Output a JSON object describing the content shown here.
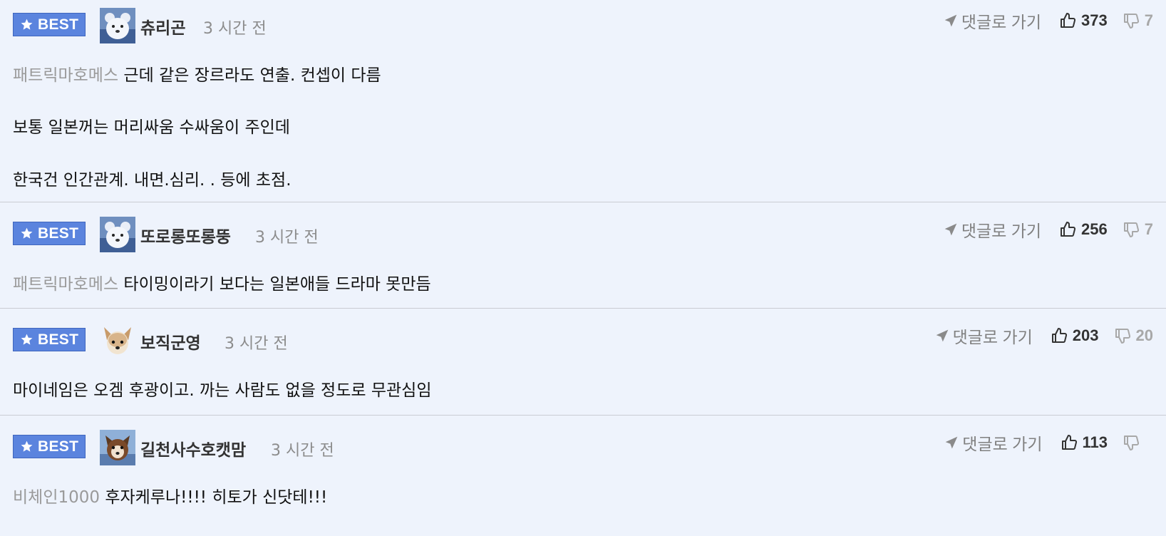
{
  "comments": [
    {
      "badge": "BEST",
      "username": "츄리곤",
      "time": "3 시간 전",
      "reply_label": "댓글로 가기",
      "likes": "373",
      "dislikes": "7",
      "avatar_icon": "bear-avatar-icon",
      "lines": [
        {
          "mention": "패트릭마호메스",
          "text": " 근데 같은 장르라도 연출. 컨셉이 다름"
        },
        {
          "mention": "",
          "text": "보통 일본꺼는 머리싸움 수싸움이 주인데"
        },
        {
          "mention": "",
          "text": "한국건 인간관계. 내면.심리. . 등에 초점."
        }
      ]
    },
    {
      "badge": "BEST",
      "username": "또로롱또롱뚱",
      "time": "3 시간 전",
      "reply_label": "댓글로 가기",
      "likes": "256",
      "dislikes": "7",
      "avatar_icon": "bear-avatar-icon",
      "lines": [
        {
          "mention": "패트릭마호메스",
          "text": " 타이밍이라기 보다는 일본애들 드라마 못만듬"
        }
      ]
    },
    {
      "badge": "BEST",
      "username": "보직군영",
      "time": "3 시간 전",
      "reply_label": "댓글로 가기",
      "likes": "203",
      "dislikes": "20",
      "avatar_icon": "dog-avatar-icon",
      "lines": [
        {
          "mention": "",
          "text": "마이네임은 오겜 후광이고. 까는 사람도 없을 정도로 무관심임"
        }
      ]
    },
    {
      "badge": "BEST",
      "username": "길천사수호캣맘",
      "time": "3 시간 전",
      "reply_label": "댓글로 가기",
      "likes": "113",
      "dislikes": "",
      "avatar_icon": "cat-avatar-icon",
      "lines": [
        {
          "mention": "비체인1000",
          "text": " 후자케루나!!!! 히토가 신닷테!!!"
        }
      ]
    }
  ],
  "colors": {
    "background": "#eef3fc",
    "badge": "#5b84de",
    "mention": "#9a9a9a",
    "divider": "#c9ccd3"
  }
}
